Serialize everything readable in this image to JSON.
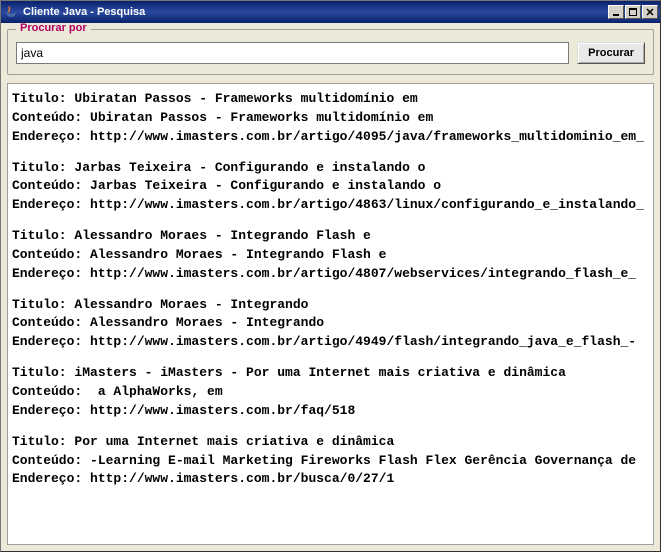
{
  "window": {
    "title": "Cliente Java - Pesquisa"
  },
  "search": {
    "legend": "Procurar por",
    "value": "java",
    "button_label": "Procurar"
  },
  "labels": {
    "titulo": "Titulo:",
    "conteudo": "Conteúdo:",
    "endereco": "Endereço:"
  },
  "results": [
    {
      "titulo": "Ubiratan Passos - Frameworks multidomínio em",
      "conteudo": "Ubiratan Passos - Frameworks multidomínio em",
      "endereco": "http://www.imasters.com.br/artigo/4095/java/frameworks_multidominio_em_"
    },
    {
      "titulo": "Jarbas Teixeira - Configurando e instalando o",
      "conteudo": "Jarbas Teixeira - Configurando e instalando o",
      "endereco": "http://www.imasters.com.br/artigo/4863/linux/configurando_e_instalando_"
    },
    {
      "titulo": "Alessandro Moraes - Integrando Flash e",
      "conteudo": "Alessandro Moraes - Integrando Flash e",
      "endereco": "http://www.imasters.com.br/artigo/4807/webservices/integrando_flash_e_"
    },
    {
      "titulo": "Alessandro Moraes - Integrando",
      "conteudo": "Alessandro Moraes - Integrando",
      "endereco": "http://www.imasters.com.br/artigo/4949/flash/integrando_java_e_flash_-"
    },
    {
      "titulo": "iMasters - iMasters - Por uma Internet mais criativa e dinâmica",
      "conteudo": " a AlphaWorks, em",
      "endereco": "http://www.imasters.com.br/faq/518"
    },
    {
      "titulo": "Por uma Internet mais criativa e dinâmica",
      "conteudo": "-Learning E-mail Marketing Fireworks Flash Flex Gerência Governança de",
      "endereco": "http://www.imasters.com.br/busca/0/27/1"
    }
  ]
}
